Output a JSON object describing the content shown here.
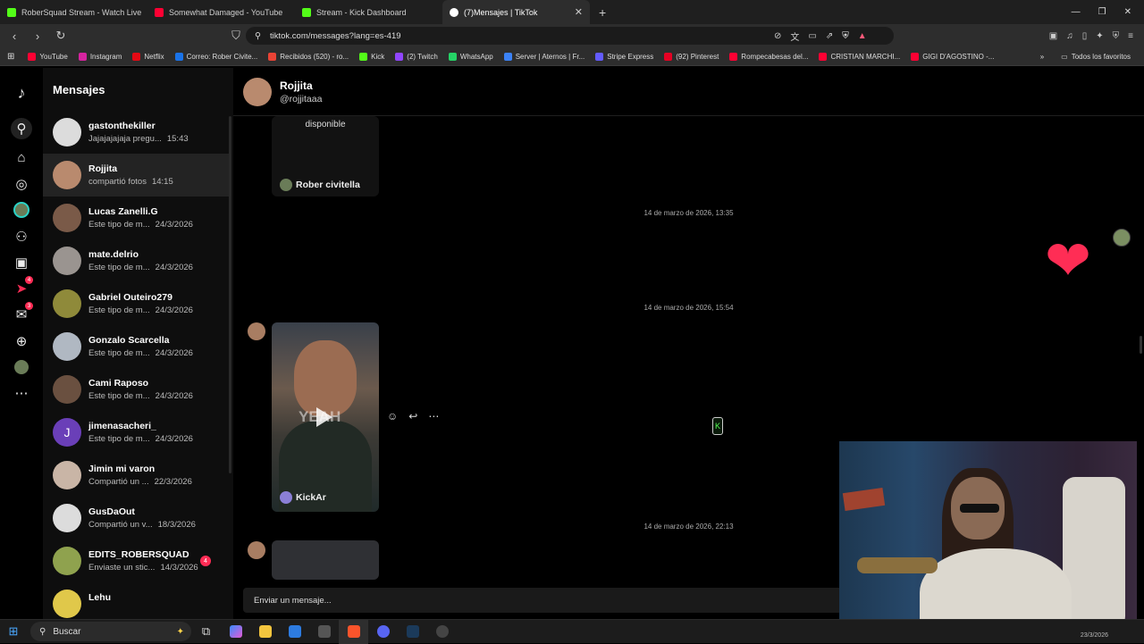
{
  "browser": {
    "tabs": [
      {
        "title": "RoberSquad Stream - Watch Live",
        "color": "#53fc18",
        "active": false
      },
      {
        "title": "Somewhat Damaged - YouTube",
        "color": "#ff0033",
        "active": false
      },
      {
        "title": "Stream - Kick Dashboard",
        "color": "#53fc18",
        "active": false
      },
      {
        "title": "(7)Mensajes | TikTok",
        "color": "#ffffff",
        "active": true
      }
    ],
    "url": "tiktok.com/messages?lang=es-419",
    "bookmarks": [
      {
        "label": "YouTube",
        "color": "#ff0033"
      },
      {
        "label": "Instagram",
        "color": "#d6249f"
      },
      {
        "label": "Netflix",
        "color": "#e50914"
      },
      {
        "label": "Correo: Rober Civite...",
        "color": "#1a73e8"
      },
      {
        "label": "Recibidos (520) - ro...",
        "color": "#ea4335"
      },
      {
        "label": "Kick",
        "color": "#53fc18"
      },
      {
        "label": "(2) Twitch",
        "color": "#9146ff"
      },
      {
        "label": "WhatsApp",
        "color": "#25d366"
      },
      {
        "label": "Server | Aternos | Fr...",
        "color": "#3b82f6"
      },
      {
        "label": "Stripe Express",
        "color": "#635bff"
      },
      {
        "label": "(92) Pinterest",
        "color": "#e60023"
      },
      {
        "label": "Rompecabesas del...",
        "color": "#ff0033"
      },
      {
        "label": "CRISTIAN MARCHI...",
        "color": "#ff0033"
      },
      {
        "label": "GIGI D'AGOSTINO -...",
        "color": "#ff0033"
      }
    ],
    "all_favorites": "Todos los favoritos"
  },
  "sidebar": {
    "title": "Mensajes",
    "rail_badges": {
      "inbox": "4",
      "messages": "3"
    },
    "conversations": [
      {
        "name": "gastonthekiller",
        "preview": "Jajajajajaja pregu...",
        "time": "15:43",
        "avatar": "#dcdcdc"
      },
      {
        "name": "Rojjita",
        "preview": "compartió fotos",
        "time": "14:15",
        "avatar": "#b98a6e"
      },
      {
        "name": "Lucas Zanelli.G",
        "preview": "Este tipo de m...",
        "time": "24/3/2026",
        "avatar": "#7a5a48"
      },
      {
        "name": "mate.delrio",
        "preview": "Este tipo de m...",
        "time": "24/3/2026",
        "avatar": "#9a9490"
      },
      {
        "name": "Gabriel Outeiro279",
        "preview": "Este tipo de m...",
        "time": "24/3/2026",
        "avatar": "#8f8a3a"
      },
      {
        "name": "Gonzalo Scarcella",
        "preview": "Este tipo de m...",
        "time": "24/3/2026",
        "avatar": "#b0b8c2"
      },
      {
        "name": "Cami Raposo",
        "preview": "Este tipo de m...",
        "time": "24/3/2026",
        "avatar": "#6a5040"
      },
      {
        "name": "jimenasacheri_",
        "preview": "Este tipo de m...",
        "time": "24/3/2026",
        "avatar": "#6a3fb8"
      },
      {
        "name": "Jimin mi varon",
        "preview": "Compartió un ...",
        "time": "22/3/2026",
        "avatar": "#c9b5a6"
      },
      {
        "name": "GusDaOut",
        "preview": "Compartió un v...",
        "time": "18/3/2026",
        "avatar": "#dcdcdc"
      },
      {
        "name": "EDITS_ROBERSQUAD",
        "preview": "Enviaste un stic...",
        "time": "14/3/2026",
        "avatar": "#8fa24e",
        "badge": "4"
      },
      {
        "name": "Lehu",
        "preview": "",
        "time": "",
        "avatar": "#e0c84a"
      }
    ],
    "jimena_initial": "J"
  },
  "chat": {
    "name": "Rojjita",
    "handle": "@rojjitaaa",
    "card1_text": "Este video no está\ndisponible",
    "card1_author": "Rober civitella",
    "dates": [
      "14 de marzo de 2026, 13:35",
      "14 de marzo de 2026, 15:54",
      "14 de marzo de 2026, 22:13"
    ],
    "heart": "❤",
    "card2_author": "KickAr",
    "card2_overlay": "YEAH",
    "composer_placeholder": "Enviar un mensaje..."
  },
  "taskbar": {
    "search": "Buscar",
    "date": "23/3/2026"
  }
}
